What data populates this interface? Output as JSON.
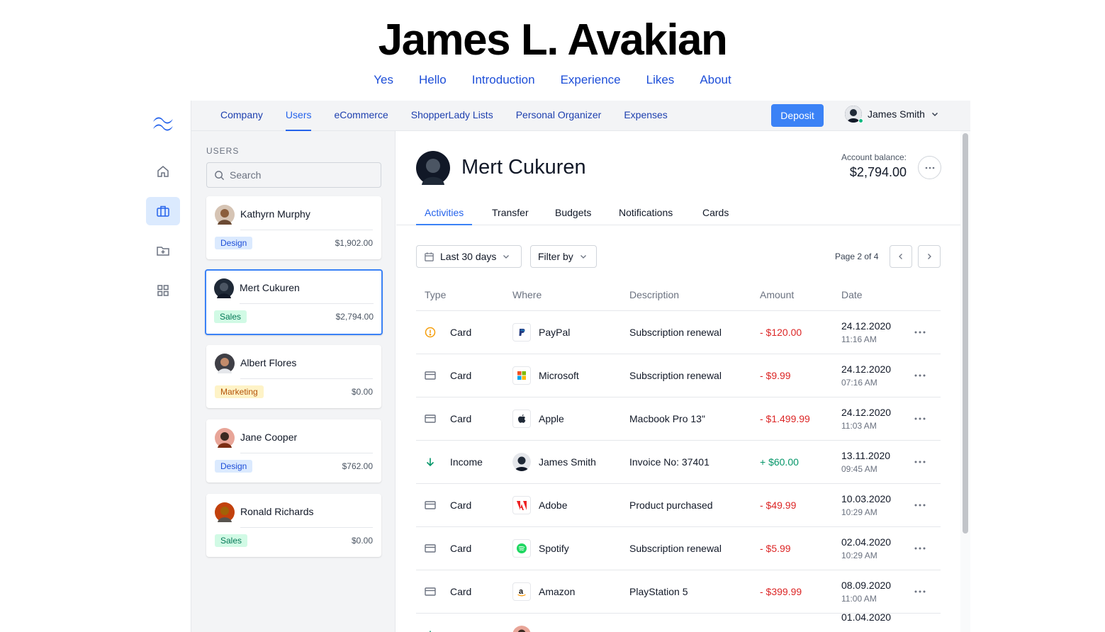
{
  "site": {
    "title": "James L. Avakian",
    "nav": [
      "Yes",
      "Hello",
      "Introduction",
      "Experience",
      "Likes",
      "About"
    ]
  },
  "rail": {
    "icons": [
      "tailwind-logo",
      "home-icon",
      "briefcase-icon",
      "folder-plus-icon",
      "grid-icon"
    ],
    "active": "briefcase-icon"
  },
  "topbar": {
    "tabs": [
      "Company",
      "Users",
      "eCommerce",
      "ShopperLady Lists",
      "Personal Organizer",
      "Expenses"
    ],
    "active_tab": "Users",
    "deposit_label": "Deposit",
    "user_name": "James Smith"
  },
  "users_panel": {
    "heading": "USERS",
    "search_placeholder": "Search",
    "users": [
      {
        "name": "Kathyrn Murphy",
        "tag": "Design",
        "amount": "$1,902.00"
      },
      {
        "name": "Mert Cukuren",
        "tag": "Sales",
        "amount": "$2,794.00",
        "selected": true
      },
      {
        "name": "Albert Flores",
        "tag": "Marketing",
        "amount": "$0.00"
      },
      {
        "name": "Jane Cooper",
        "tag": "Design",
        "amount": "$762.00"
      },
      {
        "name": "Ronald Richards",
        "tag": "Sales",
        "amount": "$0.00"
      }
    ]
  },
  "detail": {
    "name": "Mert Cukuren",
    "balance_label": "Account balance:",
    "balance": "$2,794.00",
    "tabs": [
      "Activities",
      "Transfer",
      "Budgets",
      "Notifications",
      "Cards"
    ],
    "active_tab": "Activities",
    "date_filter": "Last 30 days",
    "filter_label": "Filter by",
    "page_info": "Page 2 of 4",
    "columns": [
      "Type",
      "Where",
      "Description",
      "Amount",
      "Date"
    ],
    "rows": [
      {
        "type_icon": "warning-circle-icon",
        "type": "Card",
        "where": "PayPal",
        "where_icon": "paypal-logo",
        "description": "Subscription renewal",
        "amount": "- $120.00",
        "sign": "neg",
        "date": "24.12.2020",
        "time": "11:16 AM"
      },
      {
        "type_icon": "card-icon",
        "type": "Card",
        "where": "Microsoft",
        "where_icon": "microsoft-logo",
        "description": "Subscription renewal",
        "amount": "- $9.99",
        "sign": "neg",
        "date": "24.12.2020",
        "time": "07:16 AM"
      },
      {
        "type_icon": "card-icon",
        "type": "Card",
        "where": "Apple",
        "where_icon": "apple-logo",
        "description": "Macbook Pro 13\"",
        "amount": "- $1.499.99",
        "sign": "neg",
        "date": "24.12.2020",
        "time": "11:03 AM"
      },
      {
        "type_icon": "arrow-down-icon",
        "type": "Income",
        "where": "James Smith",
        "where_icon": "user-avatar",
        "description": "Invoice No: 37401",
        "amount": "+ $60.00",
        "sign": "pos",
        "date": "13.11.2020",
        "time": "09:45 AM"
      },
      {
        "type_icon": "card-icon",
        "type": "Card",
        "where": "Adobe",
        "where_icon": "adobe-logo",
        "description": "Product purchased",
        "amount": "- $49.99",
        "sign": "neg",
        "date": "10.03.2020",
        "time": "10:29 AM"
      },
      {
        "type_icon": "card-icon",
        "type": "Card",
        "where": "Spotify",
        "where_icon": "spotify-logo",
        "description": "Subscription renewal",
        "amount": "- $5.99",
        "sign": "neg",
        "date": "02.04.2020",
        "time": "10:29 AM"
      },
      {
        "type_icon": "card-icon",
        "type": "Card",
        "where": "Amazon",
        "where_icon": "amazon-logo",
        "description": "PlayStation 5",
        "amount": "- $399.99",
        "sign": "neg",
        "date": "08.09.2020",
        "time": "11:00 AM"
      },
      {
        "type_icon": "arrow-down-icon",
        "type": "",
        "where": "",
        "where_icon": "user-avatar",
        "description": "",
        "amount": "",
        "sign": "pos",
        "date": "01.04.2020",
        "time": ""
      }
    ]
  },
  "colors": {
    "accent": "#3b82f6",
    "link": "#1d4ed8",
    "negative": "#dc2626",
    "positive": "#059669"
  }
}
